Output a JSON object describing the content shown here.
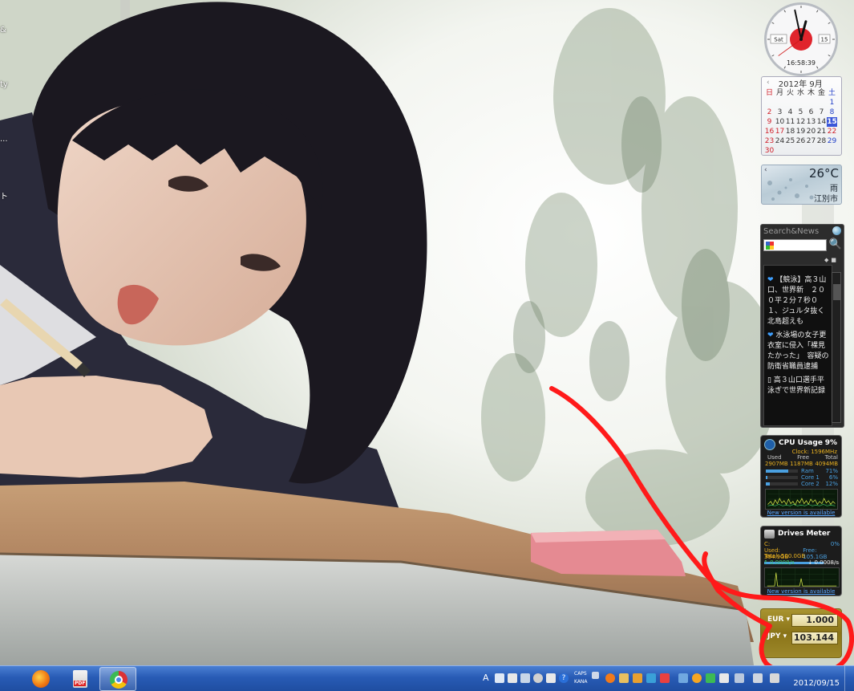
{
  "desktop": {
    "edge_fragments": [
      "&",
      "ty",
      "...",
      "ト"
    ]
  },
  "clock_gadget": {
    "day": "Sat",
    "date": "15",
    "time": "16:58:39",
    "hour_hand_deg": 15,
    "minute_hand_deg": 348,
    "second_hand_deg": 234,
    "face_accent": "#e0242c"
  },
  "calendar_gadget": {
    "title": "2012年 9月",
    "prev_arrow": "‹",
    "weekdays": [
      "日",
      "月",
      "火",
      "水",
      "木",
      "金",
      "土"
    ],
    "leading_blanks": 6,
    "days": [
      "1",
      "2",
      "3",
      "4",
      "5",
      "6",
      "7",
      "8",
      "9",
      "10",
      "11",
      "12",
      "13",
      "14",
      "15",
      "16",
      "17",
      "18",
      "19",
      "20",
      "21",
      "22",
      "23",
      "24",
      "25",
      "26",
      "27",
      "28",
      "29",
      "30"
    ],
    "today": "15",
    "holidays": [
      "17",
      "22"
    ]
  },
  "weather_gadget": {
    "temperature": "26°C",
    "condition": "雨",
    "city": "江別市",
    "prev_arrow": "‹"
  },
  "news_gadget": {
    "title": "Search&News",
    "search_placeholder": "",
    "items": [
      "【競泳】高３山口、世界新　２００平２分７秒０１、ジュルタ抜く北島超えも",
      "水泳場の女子更衣室に侵入「裸見たかった」　容疑の防衛省職員逮捕",
      "高３山口選手平泳ぎで世界新記録"
    ]
  },
  "cpu_gadget": {
    "title": "CPU Usage",
    "percent": "9%",
    "clock": "Clock: 1596MHz",
    "headers": [
      "Used",
      "Free",
      "Total"
    ],
    "values": [
      "2907MB",
      "1187MB",
      "4094MB"
    ],
    "rows": [
      {
        "label": "Ram",
        "value": "71%",
        "fill": 0.71
      },
      {
        "label": "Core 1",
        "value": "6%",
        "fill": 0.06
      },
      {
        "label": "Core 2",
        "value": "12%",
        "fill": 0.12
      }
    ],
    "link": "New version is available"
  },
  "drives_gadget": {
    "title": "Drives Meter",
    "drive": "C:",
    "percent": "0%",
    "used": "Used: 394.9GB",
    "free": "Free: 105.1GB",
    "total": "Total: 500.0GB",
    "read": "↑ 0.0008/s",
    "write": "↓ 0.0008/s",
    "usage_fill": 0.79,
    "link": "New version is available"
  },
  "currency_gadget": {
    "from_code": "EUR",
    "from_value": "1.000",
    "to_code": "JPY",
    "to_value": "103.144"
  },
  "taskbar": {
    "pinned": [
      {
        "name": "firefox-taskbar-button"
      },
      {
        "name": "pdf-taskbar-button",
        "label": "PDF"
      },
      {
        "name": "chrome-taskbar-button"
      }
    ],
    "ime": {
      "mode": "A",
      "caps": "CAPS",
      "kana": "KANA"
    },
    "date": "2012/09/15"
  },
  "colors": {
    "annotation": "#ff1a1a",
    "taskbar": "#285bb5",
    "currency": "#9d882a"
  }
}
